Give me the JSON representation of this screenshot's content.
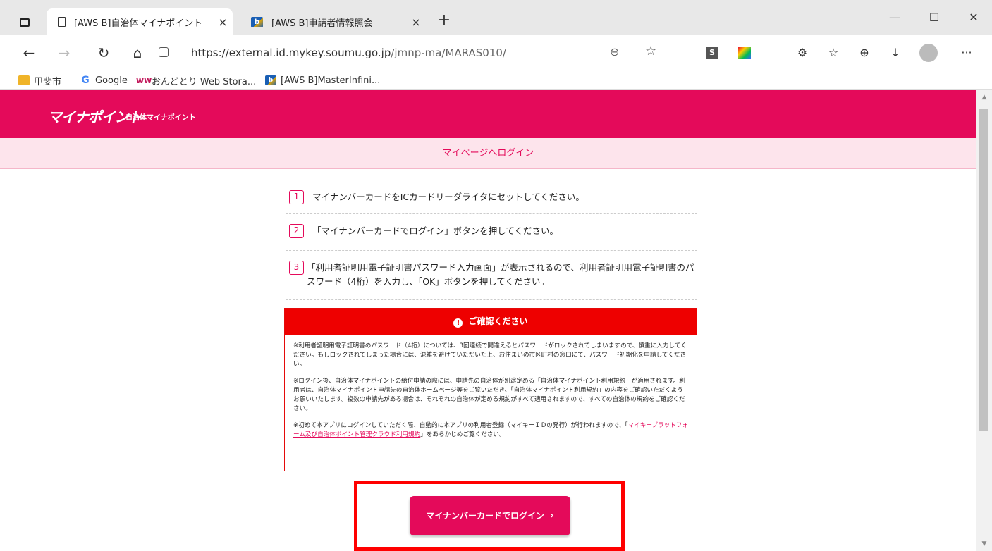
{
  "browser": {
    "tabs": [
      {
        "title": "[AWS B]自治体マイナポイント",
        "close": "×"
      },
      {
        "title": "[AWS B]申請者情報照会",
        "close": "×"
      }
    ],
    "new_tab": "+",
    "window_controls": {
      "minimize": "—",
      "maximize": "☐",
      "close": "✕"
    },
    "url_host": "https://external.id.mykey.soumu.go.jp",
    "url_path": "/jmnp-ma/MARAS010/",
    "bookmarks": [
      "甲斐市",
      "Google",
      "おんどとり Web Stora...",
      "[AWS B]MasterInfini..."
    ]
  },
  "site": {
    "logo": "マイナポイント",
    "logo_sub": "自治体マイナポイント",
    "page_heading": "マイページへログイン"
  },
  "steps": [
    {
      "num": "1",
      "text": "マイナンバーカードをICカードリーダライタにセットしてください。"
    },
    {
      "num": "2",
      "text": "「マイナンバーカードでログイン」ボタンを押してください。"
    },
    {
      "num": "3",
      "text": "「利用者証明用電子証明書パスワード入力画面」が表示されるので、利用者証明用電子証明書のパスワード（4桁）を入力し、「OK」ボタンを押してください。"
    }
  ],
  "notice": {
    "title": "ご確認ください",
    "para1": "※利用者証明用電子証明書のパスワード（4桁）については、3回連続で間違えるとパスワードがロックされてしまいますので、慎重に入力してください。もしロックされてしまった場合には、混雑を避けていただいた上、お住まいの市区町村の窓口にて、パスワード初期化を申請してください。",
    "para2": "※ログイン後、自治体マイナポイントの給付申請の際には、申請先の自治体が別途定める「自治体マイナポイント利用規約」が適用されます。利用者は、自治体マイナポイント申請先の自治体ホームページ等をご覧いただき、「自治体マイナポイント利用規約」の内容をご確認いただくようお願いいたします。複数の申請先がある場合は、それぞれの自治体が定める規約がすべて適用されますので、すべての自治体の規約をご確認ください。",
    "para3_before": "※初めて本アプリにログインしていただく際、自動的に本アプリの利用者登録（マイキーＩＤの発行）が行われますので、「",
    "para3_link": "マイキープラットフォーム及び自治体ポイント管理クラウド利用規約",
    "para3_after": "」をあらかじめご覧ください。"
  },
  "login_button": {
    "label": "マイナンバーカードでログイン",
    "chevron": "›"
  },
  "colors": {
    "brand": "#e40a5a",
    "notice_red": "#ee0000",
    "highlight": "#ff0000"
  }
}
